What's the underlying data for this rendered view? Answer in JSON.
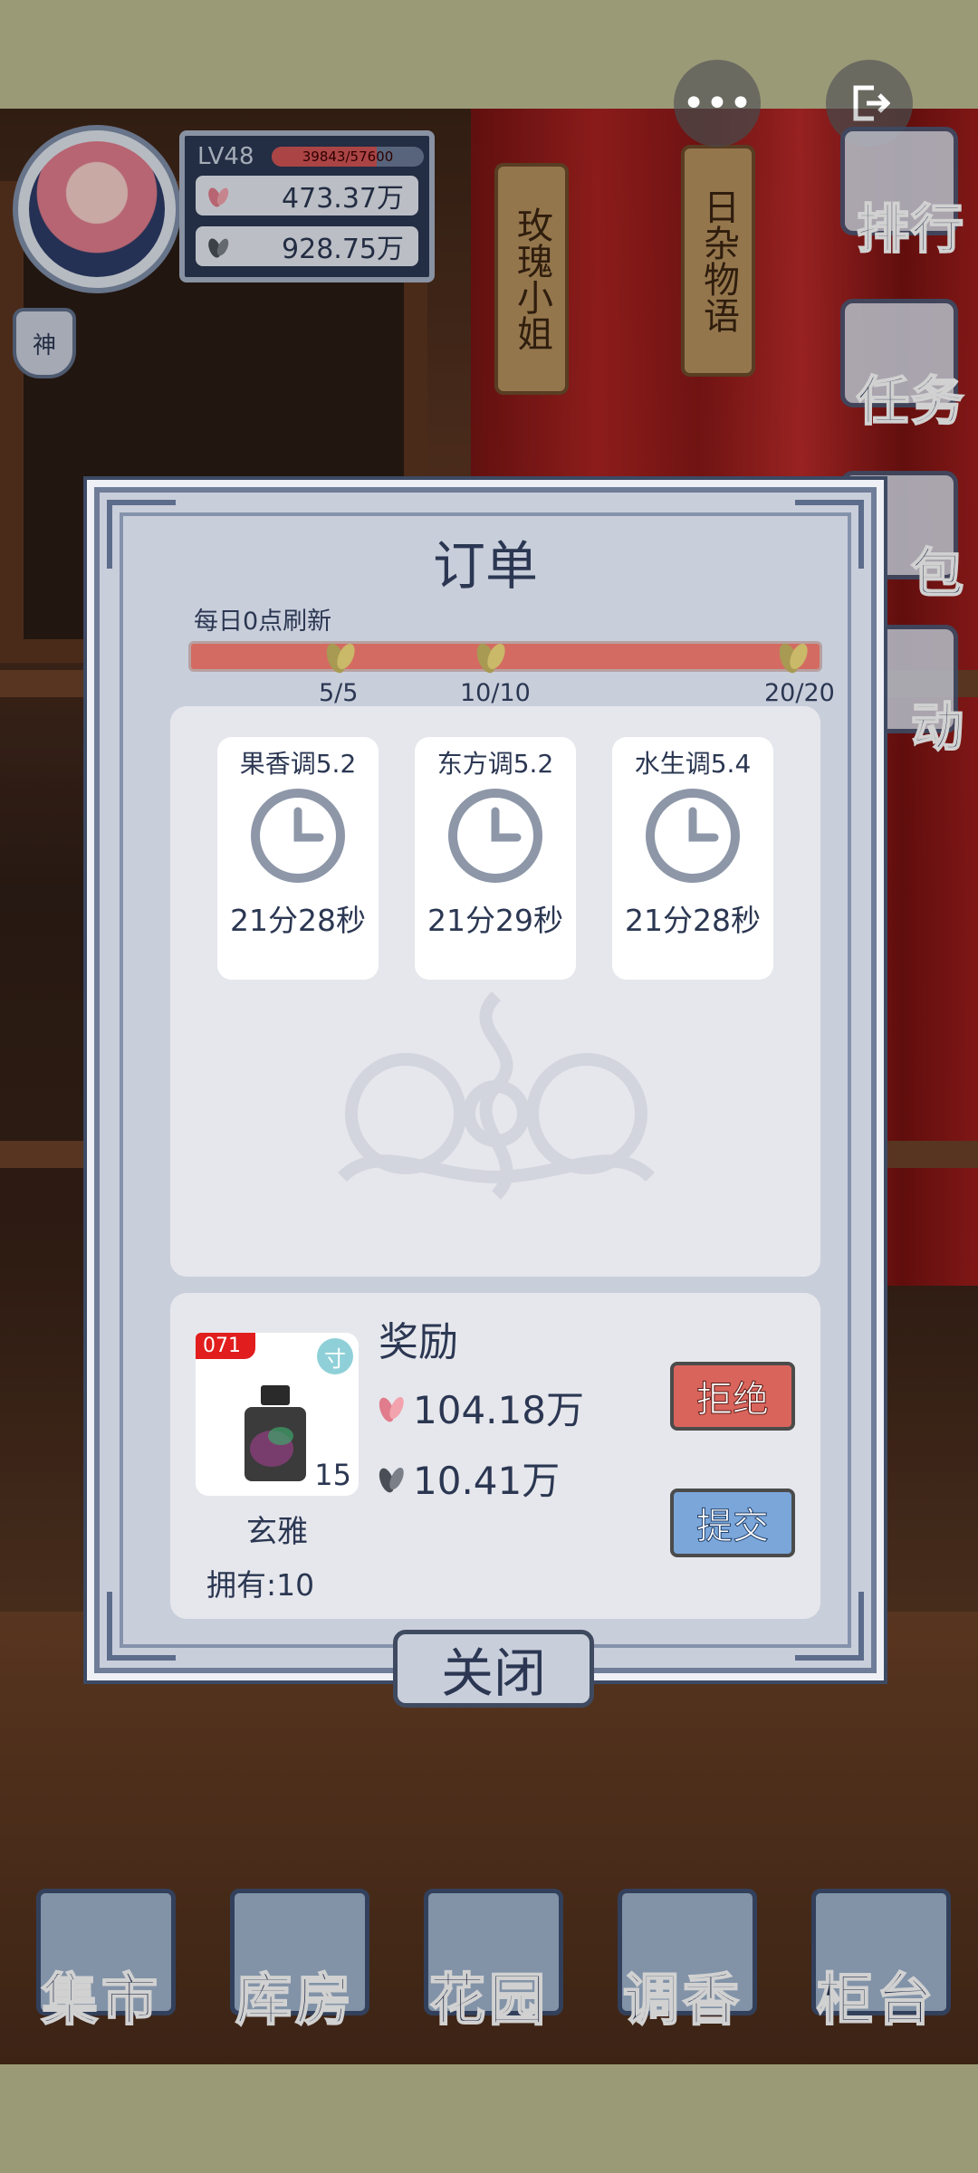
{
  "top_buttons": {
    "more_icon": "more-dots",
    "exit_icon": "exit"
  },
  "player": {
    "level": "LV48",
    "exp_text": "39843/57600",
    "exp_fraction": 0.692,
    "currency1": "473.37万",
    "currency2": "928.75万",
    "shrine_label": "神"
  },
  "scene_tags": [
    "玫瑰小姐",
    "日杂物语"
  ],
  "side_menu": [
    "排行",
    "任务",
    "包",
    "动"
  ],
  "modal": {
    "title": "订单",
    "refresh_text": "每日0点刷新",
    "progress_fraction": 1.0,
    "milestones": [
      "5/5",
      "10/10",
      "20/20"
    ],
    "orders": [
      {
        "name": "果香调5.2",
        "time": "21分28秒"
      },
      {
        "name": "东方调5.2",
        "time": "21分29秒"
      },
      {
        "name": "水生调5.4",
        "time": "21分28秒"
      }
    ],
    "item": {
      "badge": "071",
      "tag": "寸",
      "count": "15",
      "name": "玄雅",
      "owned": "拥有:10"
    },
    "reward_title": "奖励",
    "reward1": "104.18万",
    "reward2": "10.41万",
    "reject_label": "拒绝",
    "submit_label": "提交",
    "close_label": "关闭"
  },
  "bottom_nav": [
    "集市",
    "库房",
    "花园",
    "调香",
    "柜台"
  ],
  "colors": {
    "accent_red": "#d9645c",
    "accent_blue": "#7aa6da",
    "navy": "#2b3752"
  }
}
